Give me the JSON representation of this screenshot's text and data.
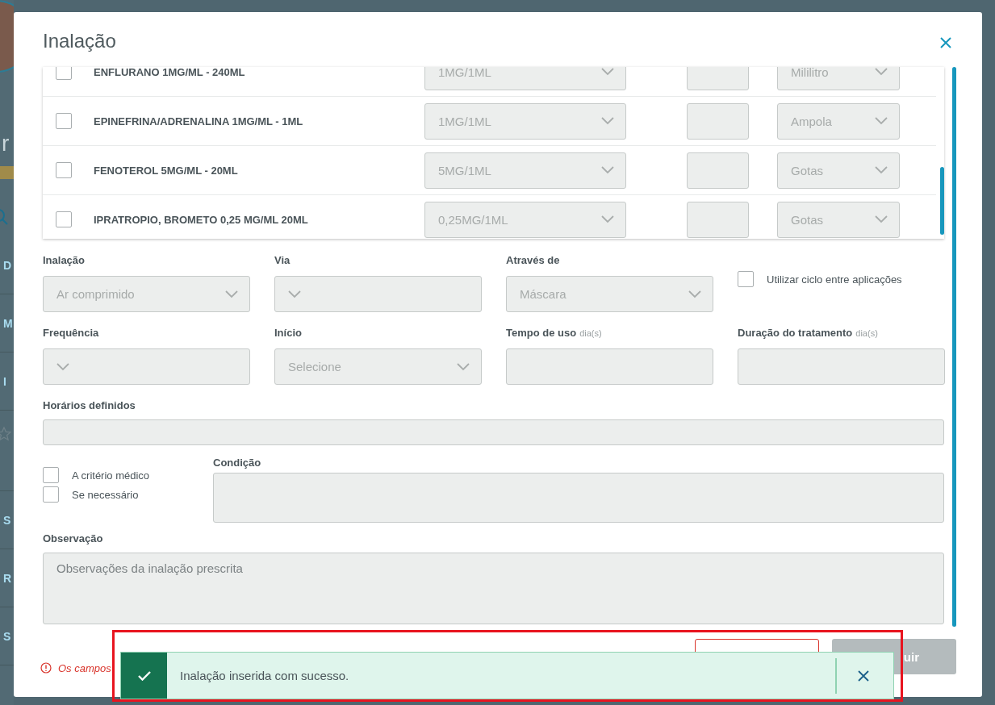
{
  "background": {
    "title": "r",
    "items": [
      {
        "kind": "text",
        "label": "D"
      },
      {
        "kind": "text",
        "label": "M"
      },
      {
        "kind": "text",
        "label": "I"
      },
      {
        "kind": "star"
      },
      {
        "kind": "text",
        "label": "S"
      },
      {
        "kind": "text",
        "label": "R"
      },
      {
        "kind": "text",
        "label": "S"
      }
    ]
  },
  "dialog": {
    "title": "Inalação"
  },
  "medications": [
    {
      "name": "ENFLURANO 1MG/ML - 240ML",
      "checked": false,
      "concentration": "1MG/1ML",
      "unit": "Mililitro"
    },
    {
      "name": "EPINEFRINA/ADRENALINA 1MG/ML - 1ML",
      "checked": false,
      "concentration": "1MG/1ML",
      "unit": "Ampola"
    },
    {
      "name": "FENOTEROL 5MG/ML - 20ML",
      "checked": false,
      "concentration": "5MG/1ML",
      "unit": "Gotas"
    },
    {
      "name": "IPRATROPIO, BROMETO 0,25 MG/ML 20ML",
      "checked": false,
      "concentration": "0,25MG/1ML",
      "unit": "Gotas"
    }
  ],
  "fields": [
    {
      "kind": "select",
      "label": "Inalação",
      "value": "Ar comprimido"
    },
    {
      "kind": "select",
      "label": "Via"
    },
    {
      "kind": "select",
      "label": "Através de",
      "value": "Máscara"
    },
    {
      "kind": "checkbox",
      "label": "Utilizar ciclo entre aplicações",
      "checked": false
    },
    {
      "kind": "select",
      "label": "Frequência"
    },
    {
      "kind": "select",
      "label": "Início",
      "placeholder": "Selecione"
    },
    {
      "kind": "input",
      "label": "Tempo de uso",
      "unit": "dia(s)"
    },
    {
      "kind": "input",
      "label": "Duração do tratamento",
      "unit": "dia(s)"
    }
  ],
  "schedule": {
    "label": "Horários definidos"
  },
  "options": [
    {
      "label": "A critério médico",
      "checked": false
    },
    {
      "label": "Se necessário",
      "checked": false
    }
  ],
  "condition": {
    "label": "Condição"
  },
  "observation": {
    "label": "Observação",
    "placeholder": "Observações da inalação prescrita"
  },
  "footer": {
    "required_note": "Os campos",
    "submit": "uir"
  },
  "toast": {
    "kind": "success",
    "message": "Inalação inserida com sucesso."
  }
}
